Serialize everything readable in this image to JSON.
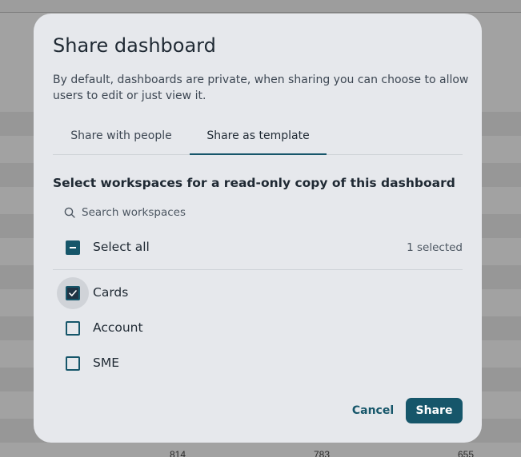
{
  "dialog": {
    "title": "Share dashboard",
    "description": "By default, dashboards are private, when sharing you can choose to allow users to edit or just view it."
  },
  "tabs": [
    {
      "label": "Share with people",
      "active": false
    },
    {
      "label": "Share as template",
      "active": true
    }
  ],
  "template": {
    "section_title": "Select workspaces for a read-only copy of this dashboard",
    "search": {
      "placeholder": "Search workspaces",
      "value": "",
      "icon": "search-icon"
    },
    "select_all": {
      "label": "Select all",
      "state": "indeterminate",
      "selected_count": "1 selected"
    },
    "workspaces": [
      {
        "label": "Cards",
        "checked": true
      },
      {
        "label": "Account",
        "checked": false
      },
      {
        "label": "SME",
        "checked": false
      }
    ]
  },
  "actions": {
    "cancel_label": "Cancel",
    "share_label": "Share"
  },
  "background": {
    "footer_numbers": [
      "814",
      "783",
      "655"
    ]
  },
  "colors": {
    "accent": "#16566a",
    "modal_bg": "#e6e8ec",
    "text": "#1f2933"
  }
}
